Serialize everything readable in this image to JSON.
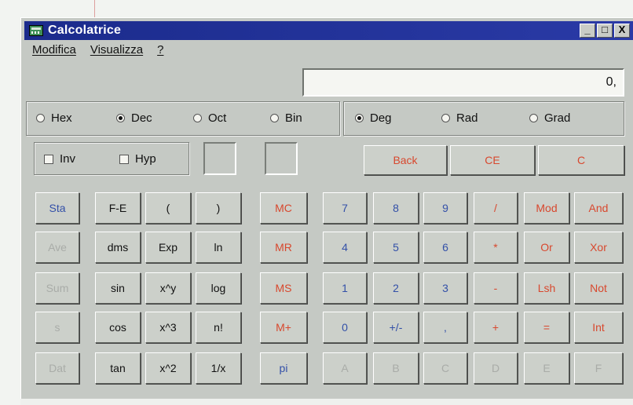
{
  "window": {
    "title": "Calcolatrice",
    "minimize": "_",
    "maximize": "□",
    "close": "X"
  },
  "menu": [
    {
      "label": "Modifica"
    },
    {
      "label": "Visualizza"
    },
    {
      "label": "?"
    }
  ],
  "display": {
    "value": "0,"
  },
  "number_system": [
    {
      "label": "Hex",
      "selected": false
    },
    {
      "label": "Dec",
      "selected": true
    },
    {
      "label": "Oct",
      "selected": false
    },
    {
      "label": "Bin",
      "selected": false
    }
  ],
  "angle_mode": [
    {
      "label": "Deg",
      "selected": true
    },
    {
      "label": "Rad",
      "selected": false
    },
    {
      "label": "Grad",
      "selected": false
    }
  ],
  "checks": [
    {
      "label": "Inv"
    },
    {
      "label": "Hyp"
    }
  ],
  "edit_buttons": [
    {
      "label": "Back"
    },
    {
      "label": "CE"
    },
    {
      "label": "C"
    }
  ],
  "stats_column": [
    "Sta",
    "Ave",
    "Sum",
    "s",
    "Dat"
  ],
  "sci_rows": [
    [
      "F-E",
      "(",
      ")"
    ],
    [
      "dms",
      "Exp",
      "ln"
    ],
    [
      "sin",
      "x^y",
      "log"
    ],
    [
      "cos",
      "x^3",
      "n!"
    ],
    [
      "tan",
      "x^2",
      "1/x"
    ]
  ],
  "memory_column": [
    "MC",
    "MR",
    "MS",
    "M+",
    "pi"
  ],
  "main_rows": [
    [
      "7",
      "8",
      "9",
      "/",
      "Mod",
      "And"
    ],
    [
      "4",
      "5",
      "6",
      "*",
      "Or",
      "Xor"
    ],
    [
      "1",
      "2",
      "3",
      "-",
      "Lsh",
      "Not"
    ],
    [
      "0",
      "+/-",
      ",",
      "+",
      "=",
      "Int"
    ],
    [
      "A",
      "B",
      "C",
      "D",
      "E",
      "F"
    ]
  ],
  "colors": {
    "title_bar": "#1b2b8c",
    "face": "#c5c9c4",
    "blue_label": "#3350a8",
    "red_label": "#d8482e",
    "disabled_label": "#a9aca8"
  }
}
